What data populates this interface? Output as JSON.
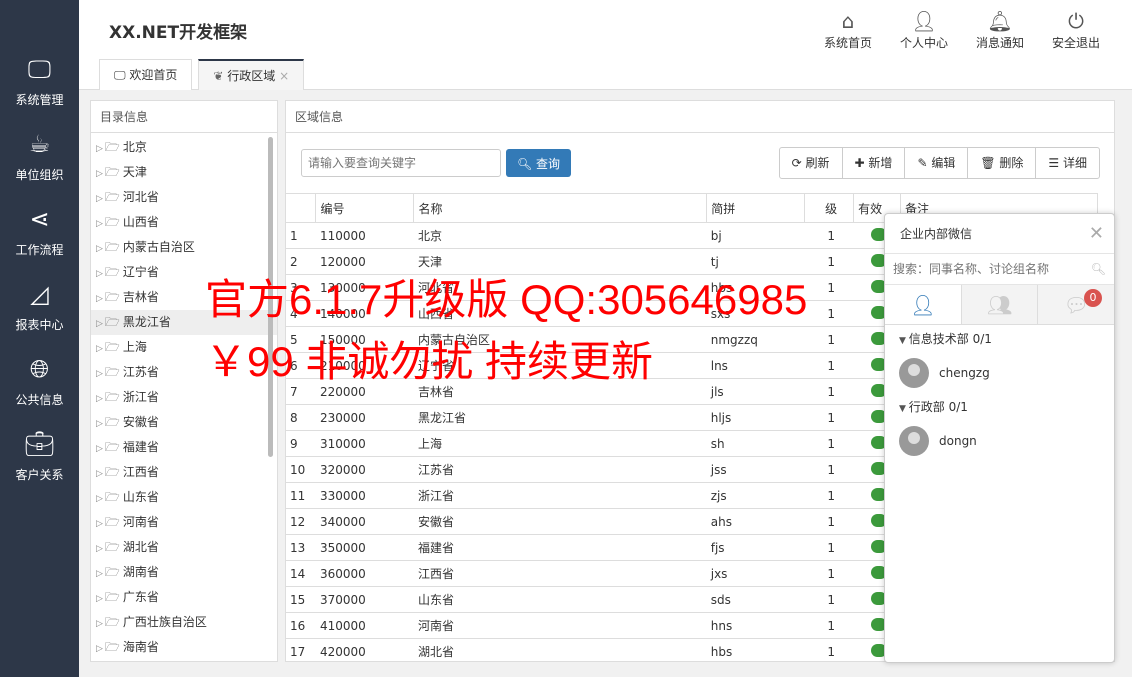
{
  "app": {
    "title": "XX.NET开发框架"
  },
  "sidebar": [
    {
      "label": "系统管理",
      "icon": "monitor-icon"
    },
    {
      "label": "单位组织",
      "icon": "coffee-icon"
    },
    {
      "label": "工作流程",
      "icon": "share-icon"
    },
    {
      "label": "报表中心",
      "icon": "area-chart-icon"
    },
    {
      "label": "公共信息",
      "icon": "globe-icon"
    },
    {
      "label": "客户关系",
      "icon": "briefcase-icon"
    }
  ],
  "topnav": [
    {
      "label": "系统首页",
      "icon": "home-icon"
    },
    {
      "label": "个人中心",
      "icon": "user-icon"
    },
    {
      "label": "消息通知",
      "icon": "bell-icon"
    },
    {
      "label": "安全退出",
      "icon": "power-icon"
    }
  ],
  "tabs": [
    {
      "label": "欢迎首页"
    },
    {
      "label": "行政区域"
    }
  ],
  "tree": {
    "title": "目录信息",
    "items": [
      "北京",
      "天津",
      "河北省",
      "山西省",
      "内蒙古自治区",
      "辽宁省",
      "吉林省",
      "黑龙江省",
      "上海",
      "江苏省",
      "浙江省",
      "安徽省",
      "福建省",
      "江西省",
      "山东省",
      "河南省",
      "湖北省",
      "湖南省",
      "广东省",
      "广西壮族自治区",
      "海南省"
    ],
    "selected": "黑龙江省"
  },
  "region": {
    "title": "区域信息",
    "search_placeholder": "请输入要查询关键字",
    "query": "查询",
    "buttons": [
      "刷新",
      "新增",
      "编辑",
      "删除",
      "详细"
    ],
    "columns": [
      "",
      "编号",
      "名称",
      "简拼",
      "级",
      "有效",
      "备注"
    ],
    "rows": [
      [
        "1",
        "110000",
        "北京",
        "bj",
        "1"
      ],
      [
        "2",
        "120000",
        "天津",
        "tj",
        "1"
      ],
      [
        "3",
        "130000",
        "河北省",
        "hbs",
        "1"
      ],
      [
        "4",
        "140000",
        "山西省",
        "sxs",
        "1"
      ],
      [
        "5",
        "150000",
        "内蒙古自治区",
        "nmgzzq",
        "1"
      ],
      [
        "6",
        "210000",
        "辽宁省",
        "lns",
        "1"
      ],
      [
        "7",
        "220000",
        "吉林省",
        "jls",
        "1"
      ],
      [
        "8",
        "230000",
        "黑龙江省",
        "hljs",
        "1"
      ],
      [
        "9",
        "310000",
        "上海",
        "sh",
        "1"
      ],
      [
        "10",
        "320000",
        "江苏省",
        "jss",
        "1"
      ],
      [
        "11",
        "330000",
        "浙江省",
        "zjs",
        "1"
      ],
      [
        "12",
        "340000",
        "安徽省",
        "ahs",
        "1"
      ],
      [
        "13",
        "350000",
        "福建省",
        "fjs",
        "1"
      ],
      [
        "14",
        "360000",
        "江西省",
        "jxs",
        "1"
      ],
      [
        "15",
        "370000",
        "山东省",
        "sds",
        "1"
      ],
      [
        "16",
        "410000",
        "河南省",
        "hns",
        "1"
      ],
      [
        "17",
        "420000",
        "湖北省",
        "hbs",
        "1"
      ]
    ]
  },
  "chat": {
    "title": "企业内部微信",
    "search_placeholder": "搜索：同事名称、讨论组名称",
    "badge": "0",
    "groups": [
      {
        "name": "信息技术部 0/1",
        "users": [
          "chengzg"
        ]
      },
      {
        "name": "行政部 0/1",
        "users": [
          "dongn"
        ]
      }
    ]
  },
  "watermark": {
    "line1": "官方6.1.7升级版 QQ:305646985",
    "line2": "￥99 非诚勿扰  持续更新"
  },
  "colors": {
    "sidebar": "#2d3748",
    "primary": "#337ab7",
    "toggle": "#3c9a3c",
    "watermark": "#ff0000"
  }
}
